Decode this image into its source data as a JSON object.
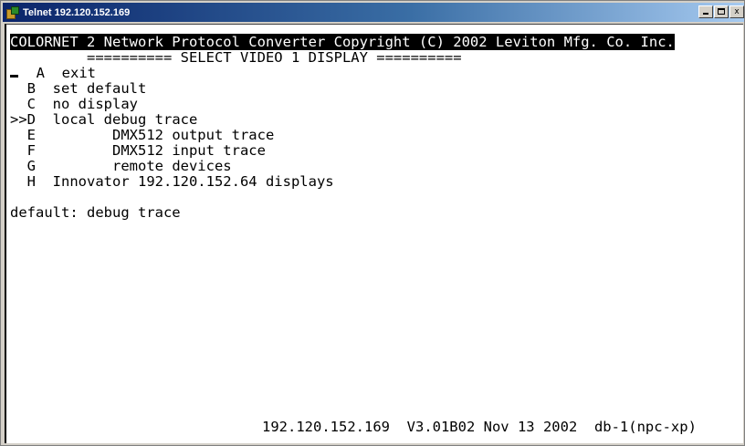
{
  "window": {
    "title": "Telnet 192.120.152.169",
    "controls": {
      "minimize": "_",
      "maximize": "□",
      "close": "x"
    }
  },
  "terminal": {
    "header": "COLORNET 2 Network Protocol Converter Copyright (C) 2002 Leviton Mfg. Co. Inc.",
    "menu_title": "         ========== SELECT VIDEO 1 DISPLAY ==========",
    "menu_items": [
      {
        "prefix": "  A",
        "label": "exit"
      },
      {
        "prefix": "  B",
        "label": "set default"
      },
      {
        "prefix": "  C",
        "label": "no display"
      },
      {
        "prefix": ">>D",
        "label": "local debug trace"
      },
      {
        "prefix": "  E",
        "label": "       DMX512 output trace"
      },
      {
        "prefix": "  F",
        "label": "       DMX512 input trace"
      },
      {
        "prefix": "  G",
        "label": "       remote devices"
      },
      {
        "prefix": "  H",
        "label": "Innovator 192.120.152.64 displays"
      }
    ],
    "default_line": "default: debug trace",
    "status_line": "192.120.152.169  V3.01B02 Nov 13 2002  db-1(npc-xp)"
  }
}
